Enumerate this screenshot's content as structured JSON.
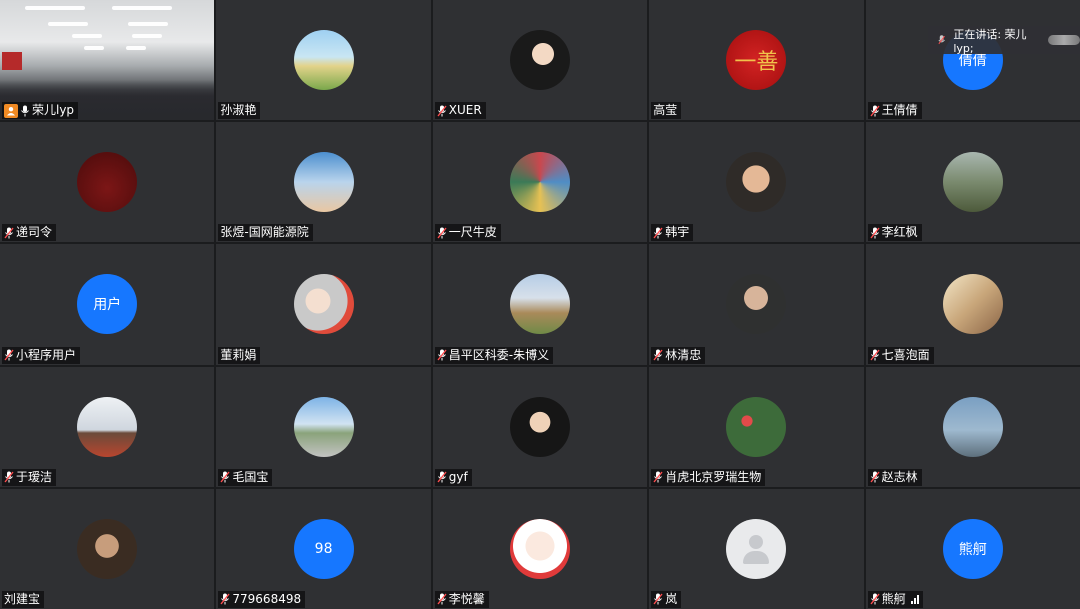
{
  "speaking_indicator": {
    "label": "正在讲话: 荣儿lyp;"
  },
  "participants": [
    {
      "name": "荣儿lyp",
      "kind": "video",
      "host": true,
      "mic": "on"
    },
    {
      "name": "孙淑艳",
      "kind": "photo",
      "bg": "bg-field",
      "mic": "none"
    },
    {
      "name": "XUER",
      "kind": "photo",
      "bg": "bg-woman",
      "mic": "muted"
    },
    {
      "name": "高莹",
      "kind": "seal",
      "seal_text": "一善",
      "bg": "bg-red",
      "mic": "none"
    },
    {
      "name": "王倩倩",
      "kind": "initials",
      "initials": "倩倩",
      "mic": "muted"
    },
    {
      "name": "递司令",
      "kind": "photo",
      "bg": "bg-moto",
      "mic": "muted"
    },
    {
      "name": "张煜-国网能源院",
      "kind": "photo",
      "bg": "bg-sky",
      "mic": "none"
    },
    {
      "name": "一尺牛皮",
      "kind": "photo",
      "bg": "bg-mural",
      "mic": "muted"
    },
    {
      "name": "韩宇",
      "kind": "photo",
      "bg": "bg-smile",
      "mic": "muted"
    },
    {
      "name": "李红枫",
      "kind": "photo",
      "bg": "bg-trees",
      "mic": "muted"
    },
    {
      "name": "小程序用户",
      "kind": "initials",
      "initials": "用户",
      "mic": "muted"
    },
    {
      "name": "董莉娟",
      "kind": "photo",
      "bg": "bg-girl",
      "mic": "none"
    },
    {
      "name": "昌平区科委-朱博义",
      "kind": "photo",
      "bg": "bg-mount",
      "mic": "muted"
    },
    {
      "name": "林清忠",
      "kind": "photo",
      "bg": "bg-man",
      "mic": "muted"
    },
    {
      "name": "七喜泡面",
      "kind": "photo",
      "bg": "bg-warm",
      "mic": "muted"
    },
    {
      "name": "于瑷洁",
      "kind": "photo",
      "bg": "bg-temple",
      "mic": "muted"
    },
    {
      "name": "毛国宝",
      "kind": "photo",
      "bg": "bg-heli",
      "mic": "muted"
    },
    {
      "name": "gyf",
      "kind": "photo",
      "bg": "bg-portrait",
      "mic": "muted"
    },
    {
      "name": "肖虎北京罗瑞生物",
      "kind": "photo",
      "bg": "bg-flowers",
      "mic": "muted"
    },
    {
      "name": "赵志林",
      "kind": "photo",
      "bg": "bg-haze",
      "mic": "muted"
    },
    {
      "name": "刘建宝",
      "kind": "photo",
      "bg": "bg-man2",
      "mic": "none"
    },
    {
      "name": "779668498",
      "kind": "initials",
      "initials": "98",
      "mic": "muted"
    },
    {
      "name": "李悦馨",
      "kind": "photo",
      "bg": "bg-doll",
      "mic": "muted"
    },
    {
      "name": "岚",
      "kind": "default",
      "mic": "muted"
    },
    {
      "name": "熊舸",
      "kind": "initials",
      "initials": "熊舸",
      "mic": "muted",
      "signal": true
    }
  ],
  "colors": {
    "tile_bg": "#2f3033",
    "avatar_blue": "#1677ff",
    "host_badge": "#f08a24",
    "muted_mic": "#ff4d4f"
  }
}
